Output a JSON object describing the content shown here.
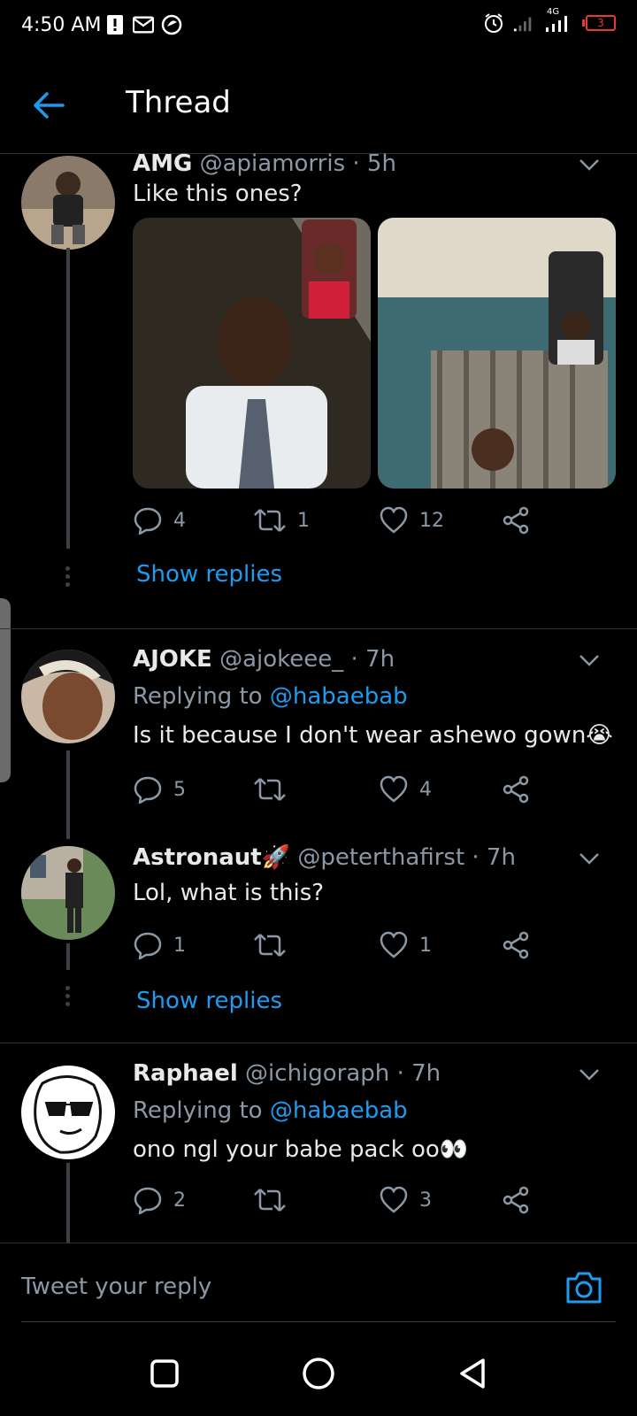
{
  "status_bar": {
    "time": "4:50 AM",
    "network": "4G",
    "battery": "3",
    "left_icons": [
      "alert-icon",
      "mail-icon",
      "app-icon"
    ],
    "right_icons": [
      "alarm-icon",
      "signal-icon",
      "signal-4g-icon",
      "battery-icon"
    ]
  },
  "header": {
    "title": "Thread",
    "back_icon": "back-arrow-icon"
  },
  "accent_color": "#1d9bf0",
  "tweets": [
    {
      "name": "AMG",
      "handle": "@apiamorris",
      "time": "· 5h",
      "text": "Like this ones?",
      "media_count": 2,
      "replies": "4",
      "retweets": "1",
      "likes": "12",
      "show_replies": "Show replies"
    },
    {
      "name": "AJOKE",
      "handle": "@ajokeee_",
      "time": "· 7h",
      "replying_prefix": "Replying to",
      "replying_to": "@habaebab",
      "text": "Is it because I don't wear ashewo gown😭",
      "replies": "5",
      "retweets": "",
      "likes": "4"
    },
    {
      "name": "Astronaut🚀",
      "handle": "@peterthafirst",
      "time": "· 7h",
      "text": "Lol, what is this?",
      "replies": "1",
      "retweets": "",
      "likes": "1",
      "show_replies": "Show replies"
    },
    {
      "name": "Raphael",
      "handle": "@ichigoraph",
      "time": "· 7h",
      "replying_prefix": "Replying to",
      "replying_to": "@habaebab",
      "text": "ono ngl your babe pack oo👀",
      "replies": "2",
      "retweets": "",
      "likes": "3"
    }
  ],
  "composer": {
    "placeholder": "Tweet your reply",
    "camera_icon": "camera-icon"
  },
  "nav_bar": {
    "icons": [
      "recents-square-icon",
      "home-circle-icon",
      "back-triangle-icon"
    ]
  }
}
